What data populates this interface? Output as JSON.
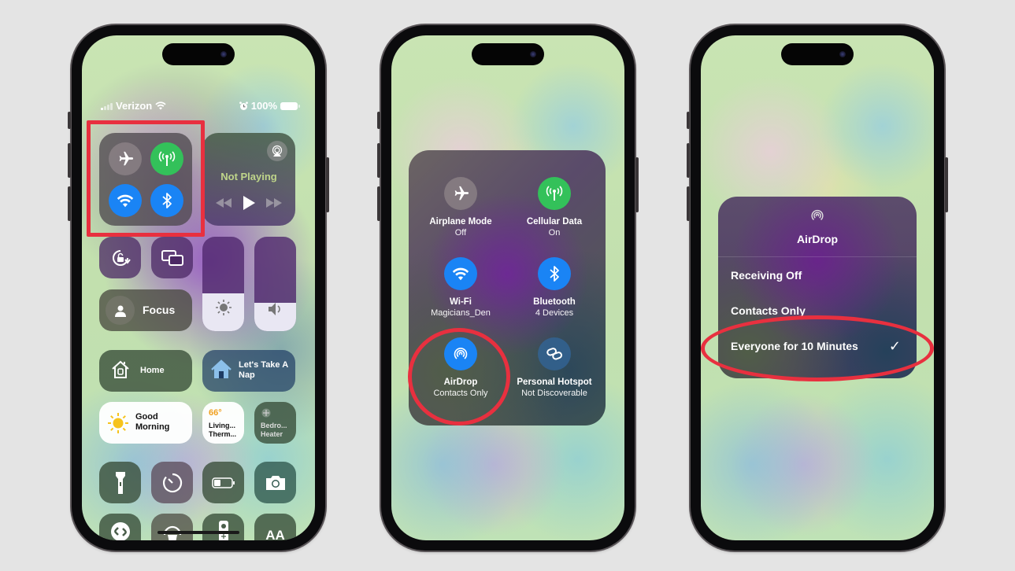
{
  "phone1": {
    "status_bar": {
      "carrier": "Verizon",
      "battery_percent": "100%",
      "icons": [
        "signal-icon",
        "wifi-icon",
        "alarm-icon",
        "battery-icon"
      ]
    },
    "connectivity": {
      "airplane": {
        "icon": "airplane-icon",
        "state": "off"
      },
      "cellular": {
        "icon": "cellular-icon",
        "state": "on"
      },
      "wifi": {
        "icon": "wifi-icon",
        "state": "on"
      },
      "bluetooth": {
        "icon": "bluetooth-icon",
        "state": "on"
      }
    },
    "now_playing": {
      "status": "Not Playing",
      "airplay_icon": "airplay-icon",
      "controls": [
        "rewind-icon",
        "play-icon",
        "fast-forward-icon"
      ]
    },
    "orientation_lock_icon": "orientation-lock-icon",
    "screen_mirroring_icon": "screen-mirroring-icon",
    "focus_label": "Focus",
    "brightness_level": 0.4,
    "volume_level": 0.3,
    "home_label": "Home",
    "scene_label": "Let's Take A Nap",
    "scene_line1": "Let's Take A",
    "scene_line2": "Nap",
    "good_morning_line1": "Good",
    "good_morning_line2": "Morning",
    "thermostat": {
      "temp": "66°",
      "line1": "Living...",
      "line2": "Therm..."
    },
    "heater": {
      "line1": "Bedro...",
      "line2": "Heater"
    },
    "row_tools": [
      "flashlight-icon",
      "timer-icon",
      "low-power-icon",
      "camera-icon"
    ],
    "row_bottom": [
      "shazam-icon",
      "hearing-icon",
      "remote-icon",
      "text-size-icon"
    ],
    "text_size_glyph": "AA",
    "annotation_color": "#e8303f"
  },
  "phone2": {
    "items": [
      {
        "title": "Airplane Mode",
        "sub": "Off",
        "icon": "airplane-icon"
      },
      {
        "title": "Cellular Data",
        "sub": "On",
        "icon": "cellular-icon"
      },
      {
        "title": "Wi-Fi",
        "sub": "Magicians_Den",
        "icon": "wifi-icon"
      },
      {
        "title": "Bluetooth",
        "sub": "4 Devices",
        "icon": "bluetooth-icon"
      },
      {
        "title": "AirDrop",
        "sub": "Contacts Only",
        "icon": "airdrop-icon"
      },
      {
        "title": "Personal Hotspot",
        "sub": "Not Discoverable",
        "icon": "hotspot-icon"
      }
    ]
  },
  "phone3": {
    "title": "AirDrop",
    "options": [
      {
        "label": "Receiving Off",
        "selected": false
      },
      {
        "label": "Contacts Only",
        "selected": false
      },
      {
        "label": "Everyone for 10 Minutes",
        "selected": true
      }
    ],
    "check_glyph": "✓"
  },
  "colors": {
    "green": "#33c15a",
    "blue": "#1a84f5",
    "annotation_red": "#e8303f",
    "thermo_orange": "#f0a020"
  }
}
